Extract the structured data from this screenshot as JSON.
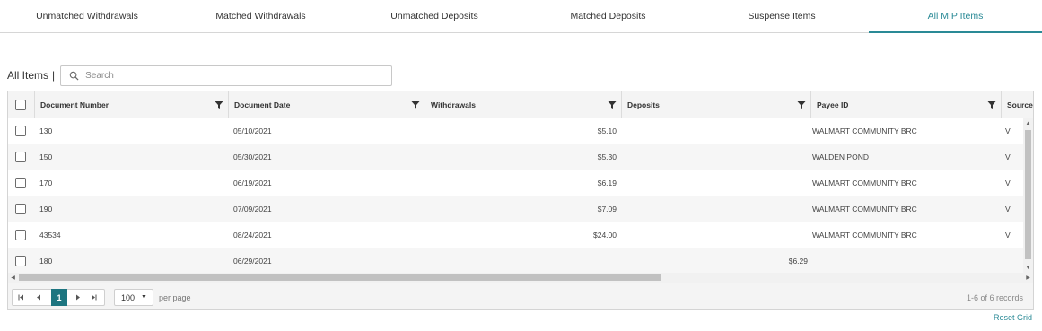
{
  "tabs": [
    {
      "label": "Unmatched Withdrawals",
      "active": false
    },
    {
      "label": "Matched Withdrawals",
      "active": false
    },
    {
      "label": "Unmatched Deposits",
      "active": false
    },
    {
      "label": "Matched Deposits",
      "active": false
    },
    {
      "label": "Suspense Items",
      "active": false
    },
    {
      "label": "All MIP Items",
      "active": true
    }
  ],
  "toolbar": {
    "title": "All Items",
    "separator": "|",
    "search_placeholder": "Search",
    "search_value": ""
  },
  "grid": {
    "columns": [
      {
        "label": "Document Number"
      },
      {
        "label": "Document Date"
      },
      {
        "label": "Withdrawals"
      },
      {
        "label": "Deposits"
      },
      {
        "label": "Payee ID"
      },
      {
        "label": "Source"
      }
    ],
    "rows": [
      {
        "document_number": "130",
        "document_date": "05/10/2021",
        "withdrawals": "$5.10",
        "deposits": "",
        "payee_id": "WALMART COMMUNITY BRC",
        "source": "V"
      },
      {
        "document_number": "150",
        "document_date": "05/30/2021",
        "withdrawals": "$5.30",
        "deposits": "",
        "payee_id": "WALDEN POND",
        "source": "V"
      },
      {
        "document_number": "170",
        "document_date": "06/19/2021",
        "withdrawals": "$6.19",
        "deposits": "",
        "payee_id": "WALMART COMMUNITY BRC",
        "source": "V"
      },
      {
        "document_number": "190",
        "document_date": "07/09/2021",
        "withdrawals": "$7.09",
        "deposits": "",
        "payee_id": "WALMART COMMUNITY BRC",
        "source": "V"
      },
      {
        "document_number": "43534",
        "document_date": "08/24/2021",
        "withdrawals": "$24.00",
        "deposits": "",
        "payee_id": "WALMART COMMUNITY BRC",
        "source": "V"
      },
      {
        "document_number": "180",
        "document_date": "06/29/2021",
        "withdrawals": "",
        "deposits": "$6.29",
        "payee_id": "",
        "source": ""
      }
    ]
  },
  "pager": {
    "current_page": "1",
    "per_page_value": "100",
    "per_page_label": "per page",
    "records_text": "1-6 of 6 records"
  },
  "reset_label": "Reset Grid",
  "icons": {
    "search": "search-icon",
    "filter": "filter-icon",
    "first_page": "first-page-icon",
    "prev_page": "prev-page-icon",
    "next_page": "next-page-icon",
    "last_page": "last-page-icon"
  },
  "colors": {
    "accent": "#2a8a96",
    "active_page": "#1d7580"
  }
}
